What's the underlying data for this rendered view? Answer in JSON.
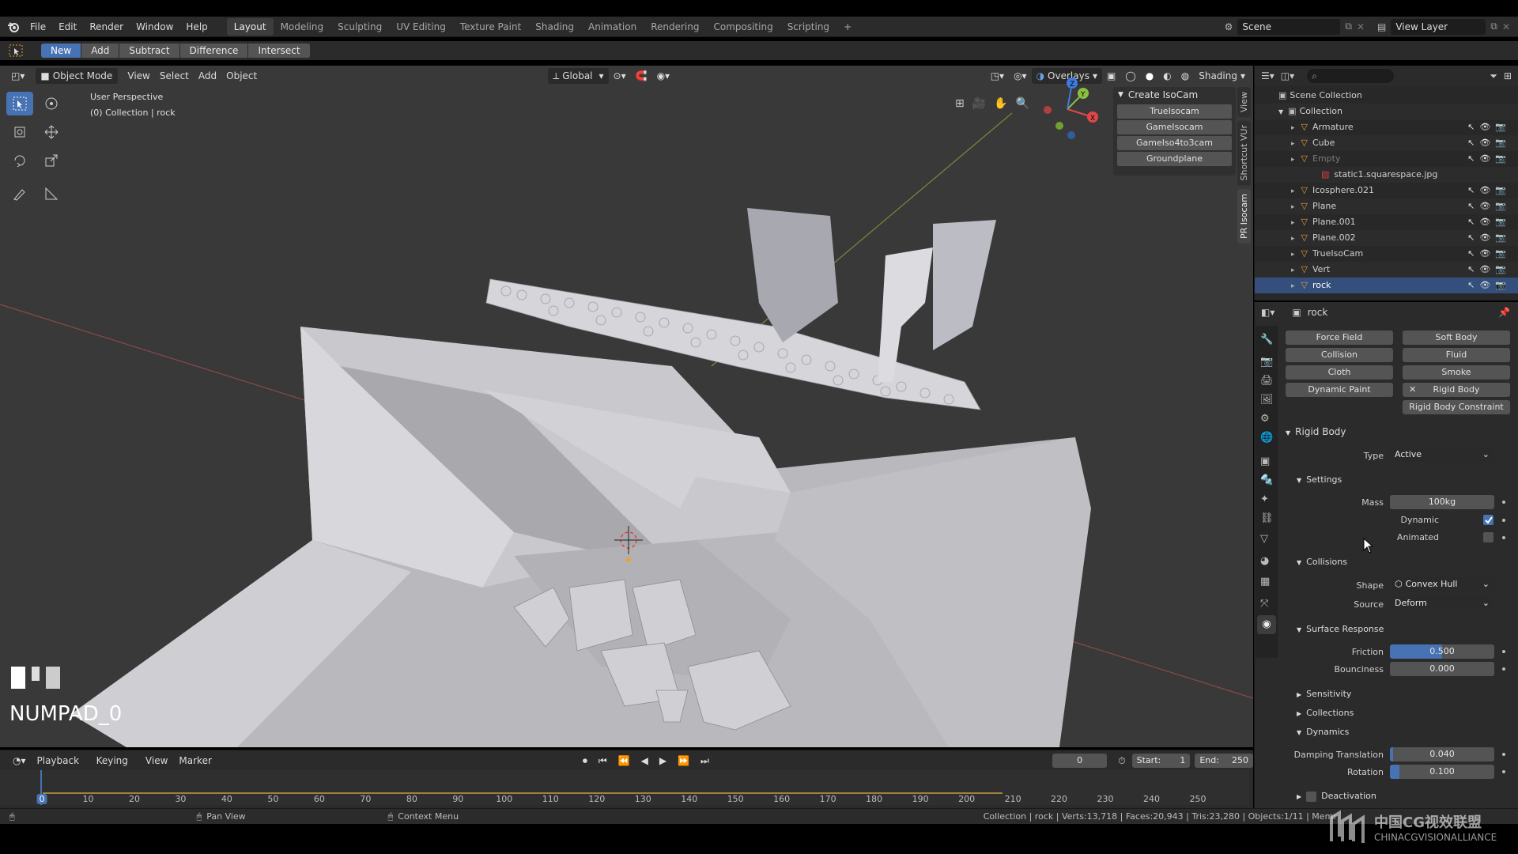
{
  "menubar": {
    "items": [
      "File",
      "Edit",
      "Render",
      "Window",
      "Help"
    ],
    "workspaces": [
      "Layout",
      "Modeling",
      "Sculpting",
      "UV Editing",
      "Texture Paint",
      "Shading",
      "Animation",
      "Rendering",
      "Compositing",
      "Scripting"
    ],
    "active_workspace": "Layout",
    "scene": "Scene",
    "view_layer": "View Layer"
  },
  "boolbar": {
    "buttons": [
      "New",
      "Add",
      "Subtract",
      "Difference",
      "Intersect"
    ],
    "active": "New"
  },
  "vp_header": {
    "mode": "Object Mode",
    "menus": [
      "View",
      "Select",
      "Add",
      "Object"
    ],
    "orientation": "Global",
    "overlays": "Overlays",
    "shading": "Shading"
  },
  "viewport": {
    "perspective": "User Perspective",
    "collection_info": "(0) Collection | rock",
    "key_overlay": "NUMPAD_0"
  },
  "npanel": {
    "tabs": [
      "View",
      "Shortcut VUr",
      "PR Isocam"
    ],
    "panel_title": "Create IsoCam",
    "buttons": [
      "TrueIsocam",
      "GameIsocam",
      "GameIso4to3cam",
      "Groundplane"
    ]
  },
  "outliner": {
    "root": "Scene Collection",
    "collection": "Collection",
    "items": [
      {
        "name": "Armature",
        "selected": false,
        "dim": false
      },
      {
        "name": "Cube",
        "selected": false,
        "dim": false
      },
      {
        "name": "Empty",
        "selected": false,
        "dim": true
      },
      {
        "name": "static1.squarespace.jpg",
        "selected": false,
        "dim": false
      },
      {
        "name": "Icosphere.021",
        "selected": false,
        "dim": false
      },
      {
        "name": "Plane",
        "selected": false,
        "dim": false
      },
      {
        "name": "Plane.001",
        "selected": false,
        "dim": false
      },
      {
        "name": "Plane.002",
        "selected": false,
        "dim": false
      },
      {
        "name": "TrueIsoCam",
        "selected": false,
        "dim": false
      },
      {
        "name": "Vert",
        "selected": false,
        "dim": false
      },
      {
        "name": "rock",
        "selected": true,
        "dim": false
      }
    ]
  },
  "properties": {
    "object_name": "rock",
    "physics_buttons": [
      "Force Field",
      "Soft Body",
      "Collision",
      "Fluid",
      "Cloth",
      "Smoke",
      "Dynamic Paint",
      "Rigid Body",
      "Rigid Body Constraint"
    ],
    "rigid_body": {
      "title": "Rigid Body",
      "type_label": "Type",
      "type_value": "Active",
      "settings_title": "Settings",
      "mass_label": "Mass",
      "mass_value": "100kg",
      "dynamic_label": "Dynamic",
      "dynamic_checked": true,
      "animated_label": "Animated",
      "animated_checked": false,
      "collisions_title": "Collisions",
      "shape_label": "Shape",
      "shape_value": "Convex Hull",
      "source_label": "Source",
      "source_value": "Deform",
      "surface_title": "Surface Response",
      "friction_label": "Friction",
      "friction_value": "0.500",
      "friction_fraction": 0.5,
      "bounciness_label": "Bounciness",
      "bounciness_value": "0.000",
      "sensitivity_title": "Sensitivity",
      "collections_title": "Collections",
      "dynamics_title": "Dynamics",
      "damping_translation_label": "Damping Translation",
      "damping_translation_value": "0.040",
      "rotation_label": "Rotation",
      "rotation_value": "0.100",
      "deactivation_label": "Deactivation"
    }
  },
  "timeline": {
    "menus": [
      "Playback",
      "Keying",
      "View",
      "Marker"
    ],
    "current_frame": "0",
    "start_label": "Start:",
    "start_value": "1",
    "end_label": "End:",
    "end_value": "250",
    "ticks": [
      "0",
      "10",
      "20",
      "30",
      "40",
      "50",
      "60",
      "70",
      "80",
      "90",
      "100",
      "110",
      "120",
      "130",
      "140",
      "150",
      "160",
      "170",
      "180",
      "190",
      "200",
      "210",
      "220",
      "230",
      "240",
      "250"
    ]
  },
  "statusbar": {
    "pan_view": "Pan View",
    "context_menu": "Context Menu",
    "stats": "Collection | rock | Verts:13,718 | Faces:20,943 | Tris:23,280 | Objects:1/11 | Mem:"
  },
  "watermark": {
    "cn": "中国CG视效联盟",
    "en": "CHINACGVISIONALLIANCE"
  },
  "colors": {
    "accent": "#4772b3",
    "selected_row": "#344f7c",
    "panel_bg": "#2b2b2b",
    "viewport_bg": "#393939"
  }
}
